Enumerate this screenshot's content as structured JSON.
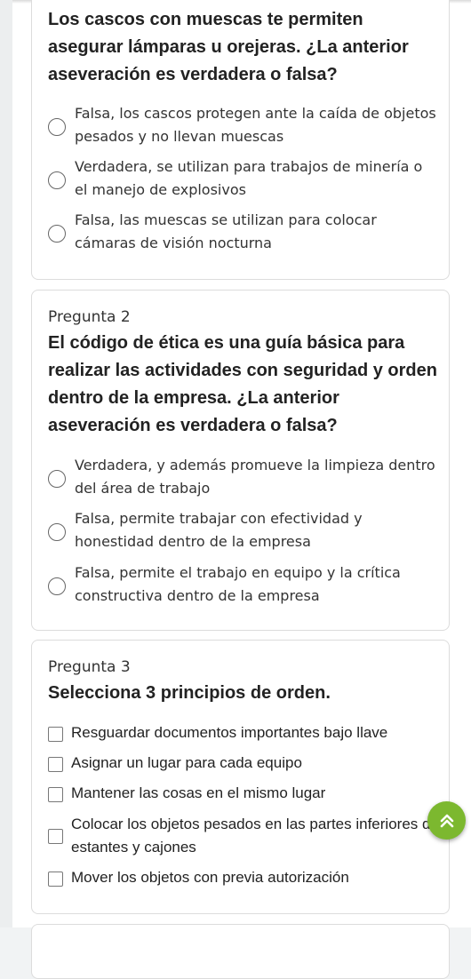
{
  "questions": [
    {
      "text": "Los cascos con muescas te permiten asegurar lámparas u orejeras. ¿La anterior aseveración es verdadera o falsa?",
      "options": [
        "Falsa, los cascos protegen ante la caída de objetos pesados y no llevan muescas",
        "Verdadera, se utilizan para trabajos de minería o el manejo de explosivos",
        "Falsa, las muescas se utilizan para colocar cámaras de visión nocturna"
      ]
    },
    {
      "label": "Pregunta 2",
      "text": "El código de ética es una guía básica para realizar las actividades con seguridad y orden dentro de la empresa. ¿La anterior aseveración es verdadera o falsa?",
      "options": [
        "Verdadera, y además promueve la limpieza dentro del área de trabajo",
        "Falsa, permite trabajar con efectividad y honestidad dentro de la empresa",
        "Falsa, permite el trabajo en equipo y la crítica constructiva dentro de la empresa"
      ]
    },
    {
      "label": "Pregunta 3",
      "text": "Selecciona 3 principios de orden.",
      "options": [
        "Resguardar documentos importantes bajo llave",
        "Asignar un lugar para cada equipo",
        "Mantener las cosas en el mismo lugar",
        "Colocar los objetos pesados en las partes inferiores de estantes y cajones",
        "Mover los objetos con previa autorización"
      ]
    }
  ],
  "scroll_top_button": {
    "icon": "double-chevron-up-icon",
    "color": "#7cb82f"
  }
}
